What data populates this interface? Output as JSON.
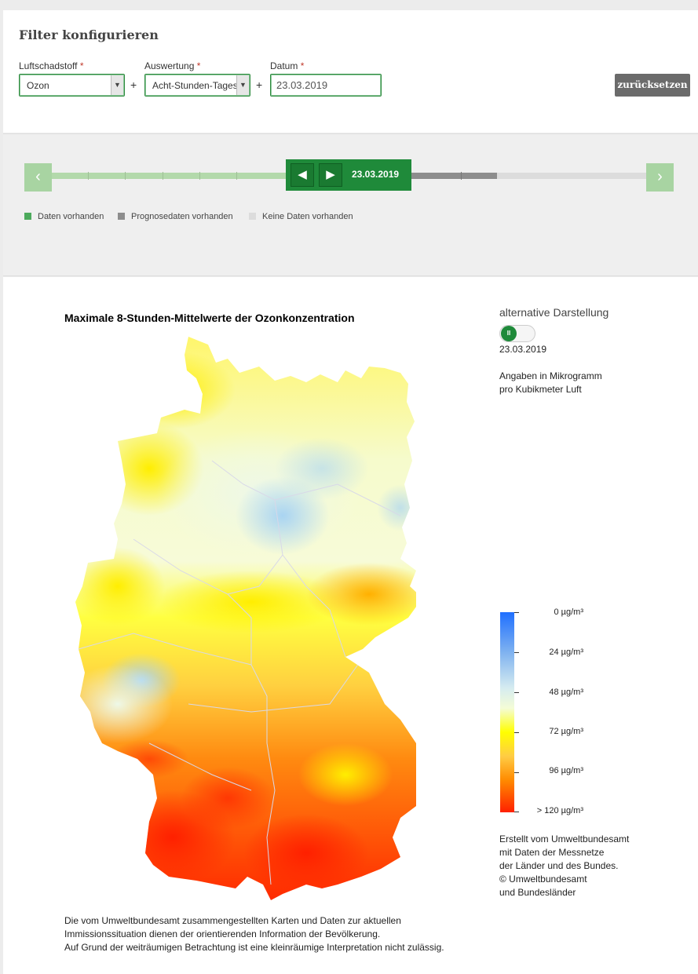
{
  "filter": {
    "title": "Filter konfigurieren",
    "pollutant": {
      "label": "Luftschadstoff",
      "required": "*",
      "value": "Ozon"
    },
    "evaluation": {
      "label": "Auswertung",
      "required": "*",
      "value": "Acht-Stunden-Tages"
    },
    "date": {
      "label": "Datum",
      "required": "*",
      "value": "23.03.2019"
    },
    "plus": "+",
    "reset_label": "zurücksetzen"
  },
  "timeline": {
    "current_date": "23.03.2019",
    "legend": [
      {
        "label": "Daten vorhanden",
        "color": "#4caa5c"
      },
      {
        "label": "Prognosedaten vorhanden",
        "color": "#8d8d8d"
      },
      {
        "label": "Keine Daten vorhanden",
        "color": "#dcdcdc"
      }
    ]
  },
  "map": {
    "title": "Maximale 8-Stunden-Mittelwerte der Ozonkonzentration",
    "alt_label": "alternative Darstellung",
    "date": "23.03.2019",
    "units_line1": "Angaben in Mikrogramm",
    "units_line2": "pro Kubikmeter Luft",
    "scale_labels": [
      "0 µg/m³",
      "24 µg/m³",
      "48 µg/m³",
      "72 µg/m³",
      "96 µg/m³",
      ">  120 µg/m³"
    ],
    "credit_lines": [
      "Erstellt vom Umweltbundesamt",
      "mit Daten der Messnetze",
      "der Länder und des Bundes.",
      "© Umweltbundesamt",
      "und Bundesländer"
    ],
    "footnote_lines": [
      "Die vom Umweltbundesamt zusammengestellten Karten und Daten zur aktuellen",
      "Immissionssituation dienen der orientierenden Information der Bevölkerung.",
      "Auf Grund der weiträumigen Betrachtung ist eine kleinräumige Interpretation nicht zulässig."
    ]
  },
  "colors": {
    "accent": "#1f8a3a",
    "reset": "#6b6b6b"
  }
}
